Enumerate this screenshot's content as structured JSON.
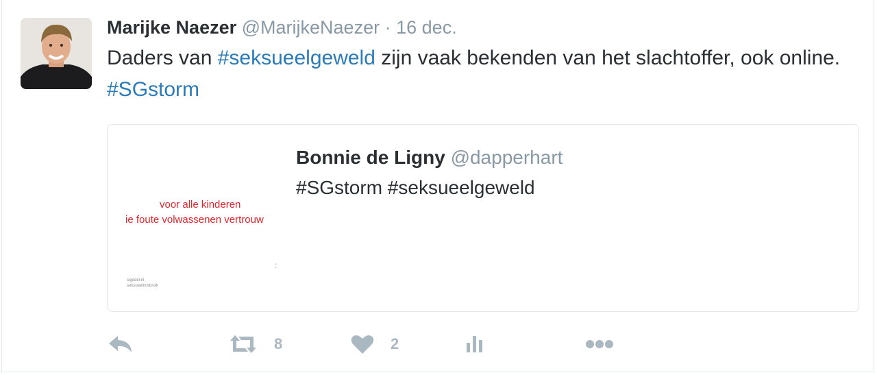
{
  "tweet": {
    "author_name": "Marijke Naezer",
    "author_handle": "@MarijkeNaezer",
    "separator": "·",
    "timestamp": "16 dec.",
    "text_parts": {
      "t1": "Daders van ",
      "h1": "#seksueelgeweld",
      "t2": " zijn vaak bekenden van het slachtoffer, ook online. ",
      "h2": "#SGstorm"
    },
    "hashtag_color": "#2b7bb9"
  },
  "quote": {
    "author_name": "Bonnie de Ligny",
    "author_handle": "@dapperhart",
    "text": "#SGstorm #seksueelgeweld",
    "media": {
      "line1": "voor alle kinderen",
      "line2": "ie foute volwassenen vertrouw",
      "small1": "sigedel.nl",
      "small2": "seksueelmisbruik",
      "text_color": "#e0262b"
    }
  },
  "actions": {
    "reply_icon": "reply-icon",
    "retweet_icon": "retweet-icon",
    "retweet_count": "8",
    "like_icon": "heart-icon",
    "like_count": "2",
    "analytics_icon": "bar-chart-icon",
    "more_icon": "more-dots-icon",
    "icon_color": "#aab8c2"
  }
}
